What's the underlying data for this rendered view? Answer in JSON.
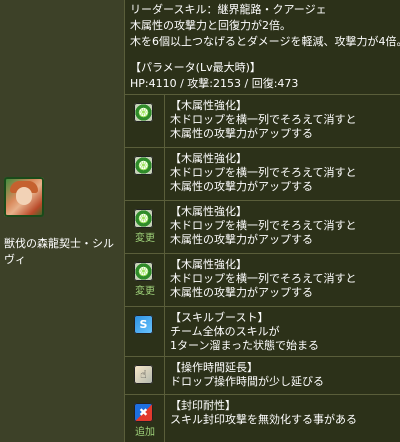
{
  "character": {
    "name": "獣伐の森龍契士・シルヴィ"
  },
  "leader": {
    "lines": [
      "リーダースキル：継界龍路・クアージェ",
      "木属性の攻撃力と回復力が2倍。",
      "木を6個以上つなげるとダメージを軽減、攻撃力が4倍。"
    ],
    "params_title": "【パラメータ(Lv最大時)】",
    "params": "HP:4110 / 攻撃:2153 / 回復:473"
  },
  "awakenings": [
    {
      "icon": "wood-enhance-icon",
      "tag": "",
      "title": "【木属性強化】",
      "lines": [
        "木ドロップを横一列でそろえて消すと",
        "木属性の攻撃力がアップする"
      ]
    },
    {
      "icon": "wood-enhance-icon",
      "tag": "",
      "title": "【木属性強化】",
      "lines": [
        "木ドロップを横一列でそろえて消すと",
        "木属性の攻撃力がアップする"
      ]
    },
    {
      "icon": "wood-enhance-icon",
      "tag": "変更",
      "title": "【木属性強化】",
      "lines": [
        "木ドロップを横一列でそろえて消すと",
        "木属性の攻撃力がアップする"
      ]
    },
    {
      "icon": "wood-enhance-icon",
      "tag": "変更",
      "title": "【木属性強化】",
      "lines": [
        "木ドロップを横一列でそろえて消すと",
        "木属性の攻撃力がアップする"
      ]
    },
    {
      "icon": "skill-boost-icon",
      "tag": "",
      "title": "【スキルブースト】",
      "lines": [
        "チーム全体のスキルが",
        "1ターン溜まった状態で始まる"
      ]
    },
    {
      "icon": "extend-time-icon",
      "tag": "",
      "title": "【操作時間延長】",
      "lines": [
        "ドロップ操作時間が少し延びる"
      ]
    },
    {
      "icon": "skill-bind-resist-icon",
      "tag": "追加",
      "title": "【封印耐性】",
      "lines": [
        "スキル封印攻撃を無効化する事がある"
      ]
    }
  ]
}
